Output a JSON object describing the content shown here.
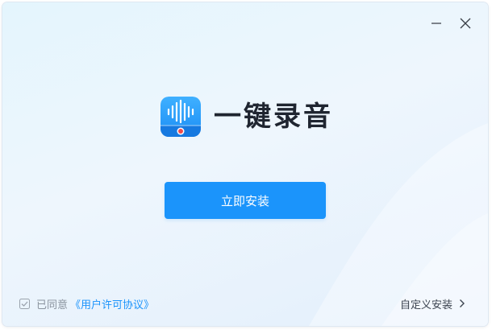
{
  "app": {
    "name": "一键录音"
  },
  "titlebar": {
    "minimize_icon": "minimize-icon",
    "close_icon": "close-icon"
  },
  "main": {
    "install_button_label": "立即安装"
  },
  "footer": {
    "agree_checked": true,
    "agree_prefix": "已同意",
    "license_link": "《用户许可协议》",
    "custom_install_label": "自定义安装",
    "custom_install_icon": "chevron-right-icon"
  },
  "colors": {
    "accent": "#1b94fb",
    "title_text": "#1f2530",
    "muted_text": "#8a939e"
  }
}
